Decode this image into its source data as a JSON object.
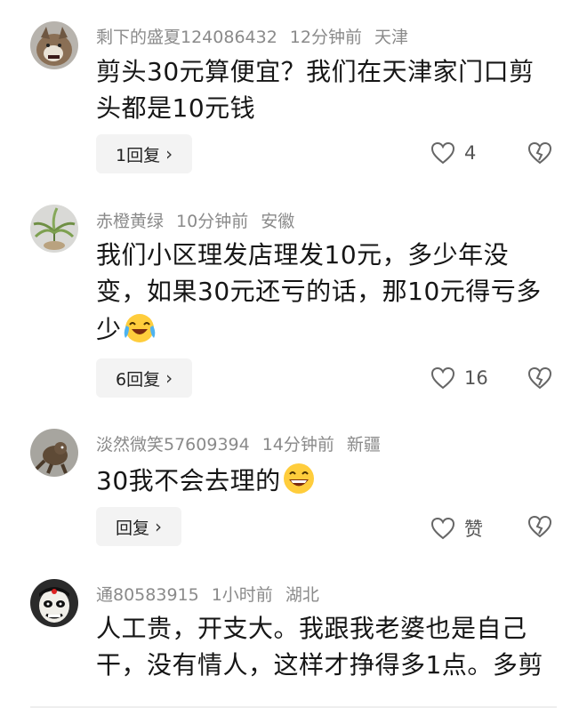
{
  "comments": [
    {
      "username": "剩下的盛夏124086432",
      "time": "12分钟前",
      "location": "天津",
      "text": "剪头30元算便宜？我们在天津家门口剪头都是10元钱",
      "reply_label": "1回复",
      "likes": "4",
      "avatar_icon": "wolf-avatar"
    },
    {
      "username": "赤橙黄绿",
      "time": "10分钟前",
      "location": "安徽",
      "text": "我们小区理发店理发10元，多少年没变，如果30元还亏的话，那10元得亏多少",
      "reply_label": "6回复",
      "likes": "16",
      "emoji": "laughing-crying-emoji",
      "avatar_icon": "plant-avatar"
    },
    {
      "username": "淡然微笑57609394",
      "time": "14分钟前",
      "location": "新疆",
      "text": "30我不会去理的",
      "reply_label": "回复",
      "likes": "赞",
      "emoji": "grinning-emoji",
      "avatar_icon": "creature-avatar"
    },
    {
      "username": "通80583915",
      "time": "1小时前",
      "location": "湖北",
      "text": "人工贵，开支大。我跟我老婆也是自己干，没有情人，这样才挣得多1点。多剪",
      "avatar_icon": "opera-mask-avatar"
    }
  ],
  "colors": {
    "meta": "#8a8a8a",
    "button_bg": "#f3f3f3",
    "text": "#161616"
  }
}
